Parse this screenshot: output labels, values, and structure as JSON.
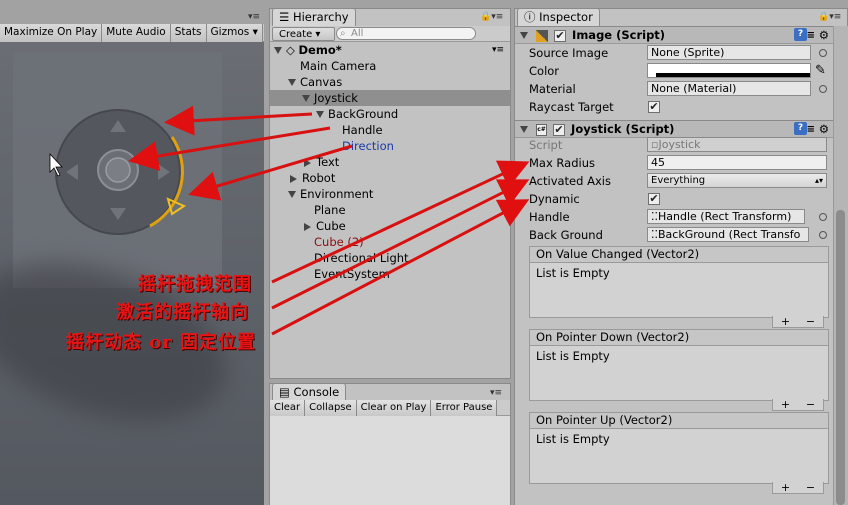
{
  "game": {
    "toolbar": [
      "Maximize On Play",
      "Mute Audio",
      "Stats",
      "Gizmos"
    ]
  },
  "hierarchy": {
    "tab": "Hierarchy",
    "create": "Create",
    "search_placeholder": "All",
    "items": [
      {
        "label": "Demo*",
        "depth": 0,
        "expanded": true,
        "bold": true
      },
      {
        "label": "Main Camera",
        "depth": 1
      },
      {
        "label": "Canvas",
        "depth": 1,
        "expanded": true
      },
      {
        "label": "Joystick",
        "depth": 2,
        "expanded": true,
        "selected": true
      },
      {
        "label": "BackGround",
        "depth": 3,
        "expanded": true
      },
      {
        "label": "Handle",
        "depth": 4
      },
      {
        "label": "Direction",
        "depth": 4,
        "blue": true
      },
      {
        "label": "Text",
        "depth": 2,
        "collapsed": true
      },
      {
        "label": "Robot",
        "depth": 1,
        "collapsed": true
      },
      {
        "label": "Environment",
        "depth": 1,
        "expanded": true
      },
      {
        "label": "Plane",
        "depth": 2
      },
      {
        "label": "Cube",
        "depth": 2,
        "collapsed": true
      },
      {
        "label": "Cube (2)",
        "depth": 2,
        "red": true
      },
      {
        "label": "Directional Light",
        "depth": 2
      },
      {
        "label": "EventSystem",
        "depth": 2
      }
    ]
  },
  "console": {
    "tab": "Console",
    "buttons": [
      "Clear",
      "Collapse",
      "Clear on Play",
      "Error Pause"
    ]
  },
  "inspector": {
    "tab": "Inspector",
    "image_component": {
      "title": "Image (Script)",
      "source_image_label": "Source Image",
      "source_image_value": "None (Sprite)",
      "color_label": "Color",
      "material_label": "Material",
      "material_value": "None (Material)",
      "raycast_label": "Raycast Target"
    },
    "joystick_component": {
      "title": "Joystick (Script)",
      "script_label": "Script",
      "script_value": "Joystick",
      "max_radius_label": "Max Radius",
      "max_radius_value": "45",
      "axis_label": "Activated Axis",
      "axis_value": "Everything",
      "dynamic_label": "Dynamic",
      "handle_label": "Handle",
      "handle_value": "Handle (Rect Transform)",
      "background_label": "Back Ground",
      "background_value": "BackGround (Rect Transfo"
    },
    "events": [
      {
        "title": "On Value Changed (Vector2)",
        "body": "List is Empty"
      },
      {
        "title": "On Pointer Down (Vector2)",
        "body": "List is Empty"
      },
      {
        "title": "On Pointer Up (Vector2)",
        "body": "List is Empty"
      }
    ]
  },
  "annotations": [
    "摇杆拖拽范围",
    "激活的摇杆轴向",
    "摇杆动态 or 固定位置"
  ],
  "colors": {
    "panel": "#c2c2c2",
    "arrow": "#e01010",
    "selected_row": "#8f8f8f"
  }
}
